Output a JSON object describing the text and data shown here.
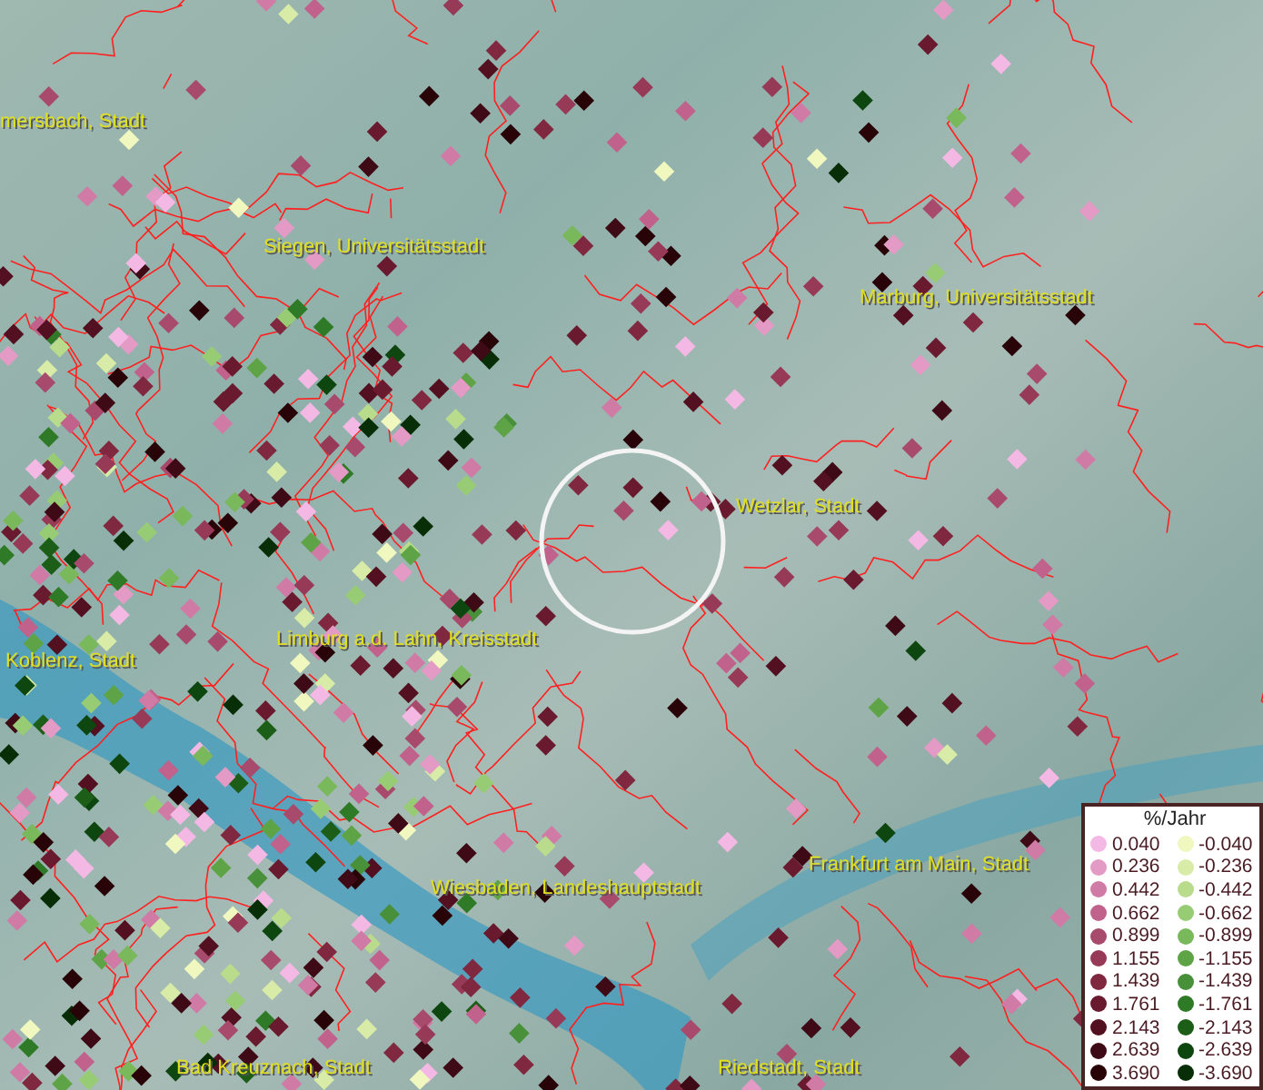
{
  "map": {
    "places": [
      {
        "name": "mersbach, Stadt"
      },
      {
        "name": "Siegen, Universitätsstadt"
      },
      {
        "name": "Marburg, Universitätsstadt"
      },
      {
        "name": "Wetzlar, Stadt"
      },
      {
        "name": "Limburg a.d. Lahn, Kreisstadt"
      },
      {
        "name": "Koblenz, Stadt"
      },
      {
        "name": "Frankfurt am Main, Stadt"
      },
      {
        "name": "Wiesbaden, Landeshauptstadt"
      },
      {
        "name": "Bad Kreuznach, Stadt"
      },
      {
        "name": "Riedstadt, Stadt"
      }
    ]
  },
  "legend": {
    "title": "%/Jahr",
    "positive": [
      {
        "label": "0.040",
        "color": "#f4b8e4"
      },
      {
        "label": "0.236",
        "color": "#e39ac4"
      },
      {
        "label": "0.442",
        "color": "#d07aa6"
      },
      {
        "label": "0.662",
        "color": "#c0628c"
      },
      {
        "label": "0.899",
        "color": "#a84a6c"
      },
      {
        "label": "1.155",
        "color": "#963a58"
      },
      {
        "label": "1.439",
        "color": "#80283f"
      },
      {
        "label": "1.761",
        "color": "#6a1a2e"
      },
      {
        "label": "2.143",
        "color": "#521020"
      },
      {
        "label": "2.639",
        "color": "#3e0a16"
      },
      {
        "label": "3.690",
        "color": "#280408"
      }
    ],
    "negative": [
      {
        "label": "-0.040",
        "color": "#f0f8c0"
      },
      {
        "label": "-0.236",
        "color": "#d8eca8"
      },
      {
        "label": "-0.442",
        "color": "#b8dc8c"
      },
      {
        "label": "-0.662",
        "color": "#98cc74"
      },
      {
        "label": "-0.899",
        "color": "#7ab85c"
      },
      {
        "label": "-1.155",
        "color": "#5ea446"
      },
      {
        "label": "-1.439",
        "color": "#48903a"
      },
      {
        "label": "-1.761",
        "color": "#2e7a26"
      },
      {
        "label": "-2.143",
        "color": "#1c5e18"
      },
      {
        "label": "-2.639",
        "color": "#0e4610"
      },
      {
        "label": "-3.690",
        "color": "#082e08"
      }
    ]
  }
}
